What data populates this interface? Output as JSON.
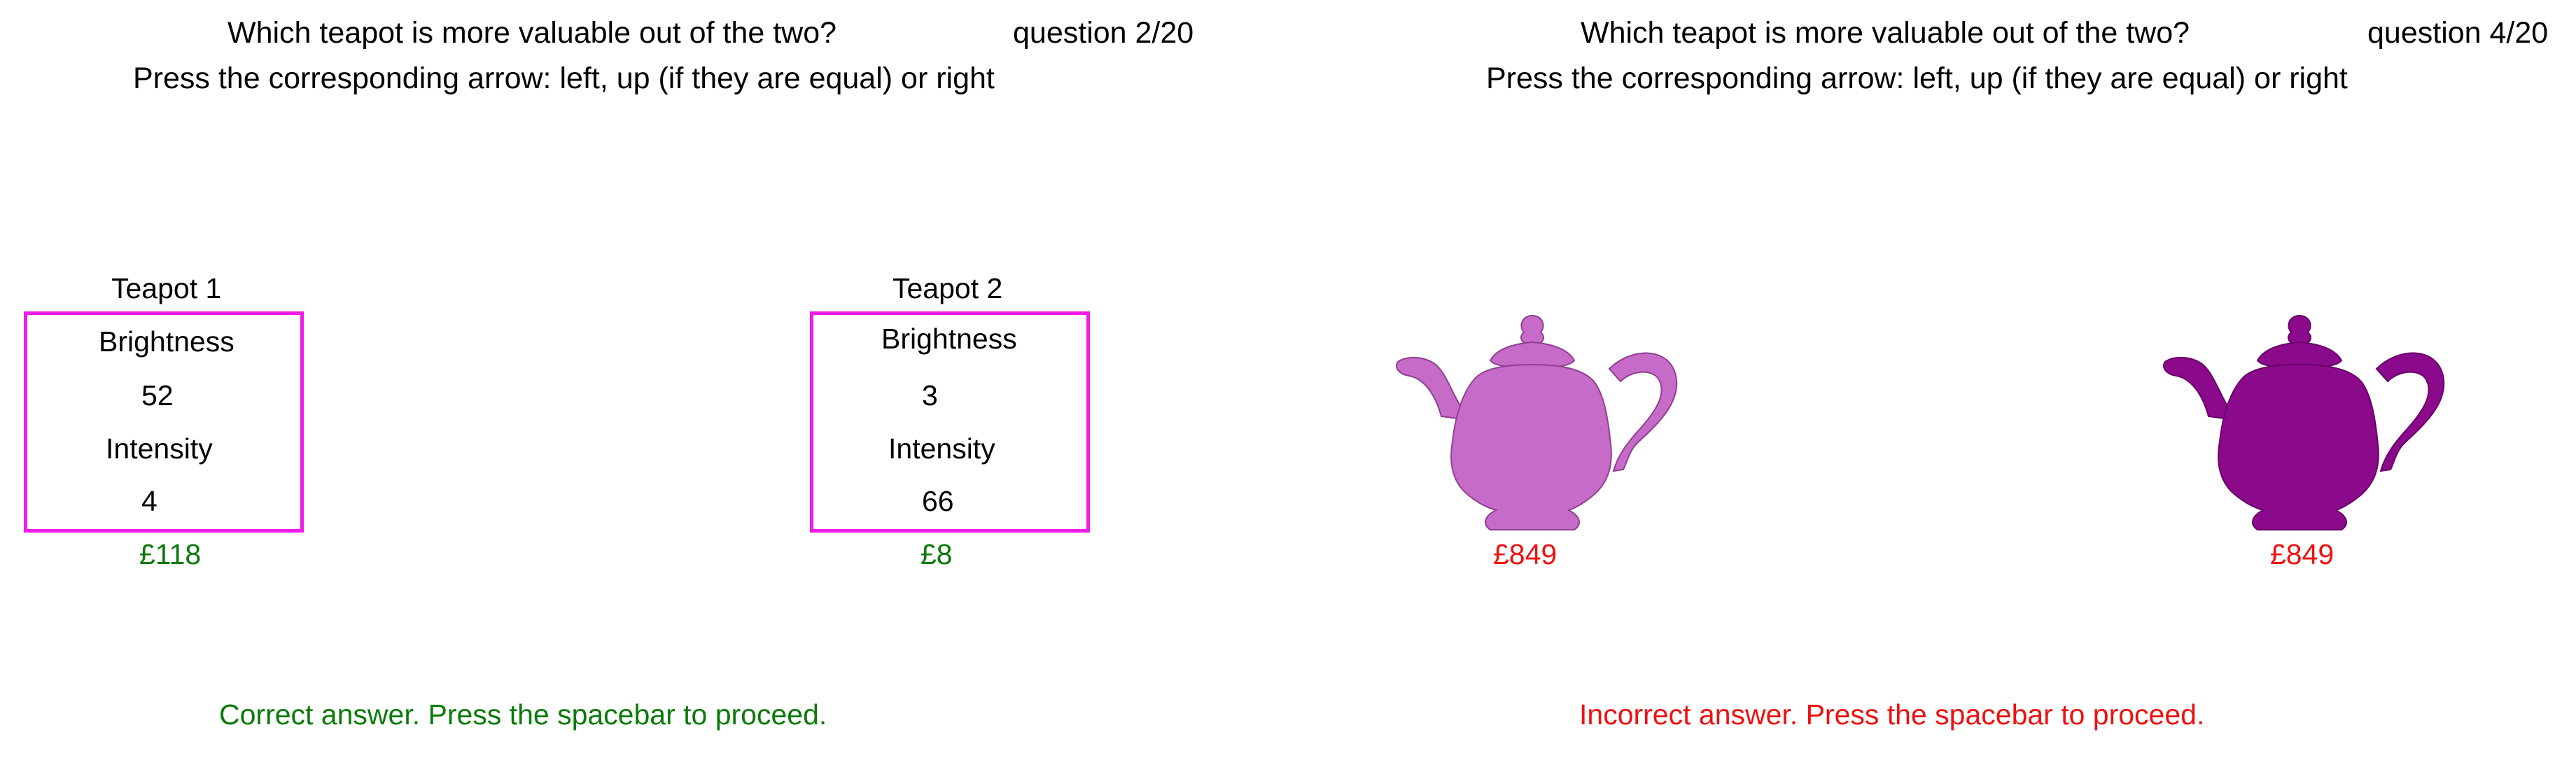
{
  "colors": {
    "box_border": "#ef1bea",
    "correct": "#0a7a0a",
    "incorrect": "#ee1111",
    "teapot_light": "#c76bc9",
    "teapot_dark": "#8b0a8b"
  },
  "left_panel": {
    "question_line1": "Which teapot is more valuable out of the two?",
    "question_line2": "Press the corresponding arrow: left, up (if they are equal) or right",
    "counter": "question 2/20",
    "teapot1": {
      "title": "Teapot 1",
      "attr1_label": "Brightness",
      "attr1_value": "52",
      "attr2_label": "Intensity",
      "attr2_value": "4",
      "price": "£118"
    },
    "teapot2": {
      "title": "Teapot 2",
      "attr1_label": "Brightness",
      "attr1_value": "3",
      "attr2_label": "Intensity",
      "attr2_value": "66",
      "price": "£8"
    },
    "feedback": "Correct answer. Press the spacebar to proceed."
  },
  "right_panel": {
    "question_line1": "Which teapot is more valuable out of the two?",
    "question_line2": "Press the corresponding arrow: left, up (if they are equal) or right",
    "counter": "question 4/20",
    "teapot_left": {
      "icon": "teapot-icon",
      "price": "£849"
    },
    "teapot_right": {
      "icon": "teapot-icon",
      "price": "£849"
    },
    "feedback": "Incorrect answer. Press the spacebar to proceed."
  }
}
